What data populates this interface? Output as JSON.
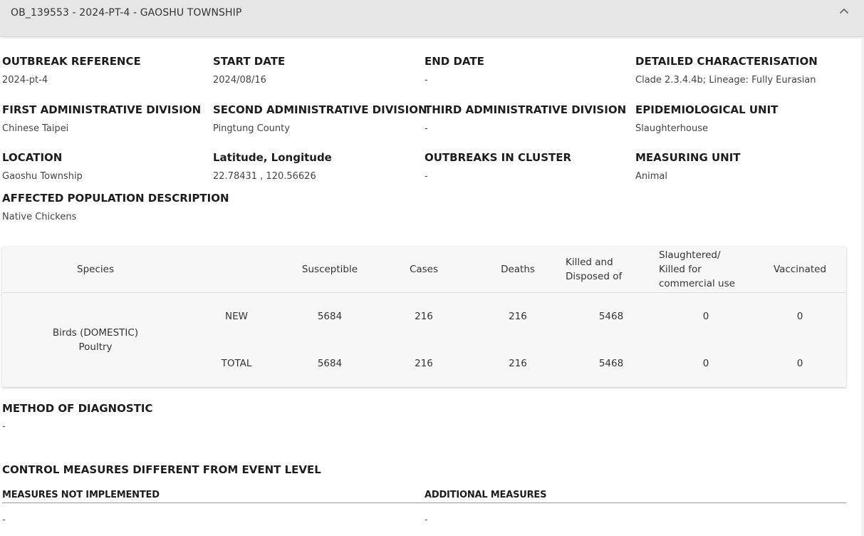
{
  "header": {
    "title": "OB_139553 - 2024-PT-4 - GAOSHU TOWNSHIP",
    "collapse_icon": "chevron-up-icon"
  },
  "fields": {
    "outbreak_reference": {
      "label": "OUTBREAK REFERENCE",
      "value": "2024-pt-4"
    },
    "start_date": {
      "label": "START DATE",
      "value": "2024/08/16"
    },
    "end_date": {
      "label": "END DATE",
      "value": "-"
    },
    "detailed_characterisation": {
      "label": "DETAILED CHARACTERISATION",
      "value": "Clade 2.3.4.4b; Lineage: Fully Eurasian"
    },
    "first_admin_division": {
      "label": "FIRST ADMINISTRATIVE DIVISION",
      "value": "Chinese Taipei"
    },
    "second_admin_division": {
      "label": "SECOND ADMINISTRATIVE DIVISION",
      "value": "Pingtung County"
    },
    "third_admin_division": {
      "label": "THIRD ADMINISTRATIVE DIVISION",
      "value": "-"
    },
    "epidemiological_unit": {
      "label": "EPIDEMIOLOGICAL UNIT",
      "value": "Slaughterhouse"
    },
    "location": {
      "label": "LOCATION",
      "value": "Gaoshu Township"
    },
    "lat_long": {
      "label": "Latitude, Longitude",
      "value": "22.78431 , 120.56626"
    },
    "outbreaks_in_cluster": {
      "label": "OUTBREAKS IN CLUSTER",
      "value": "-"
    },
    "measuring_unit": {
      "label": "MEASURING UNIT",
      "value": "Animal"
    },
    "affected_population": {
      "label": "AFFECTED POPULATION DESCRIPTION",
      "value": "Native Chickens"
    }
  },
  "table": {
    "headers": {
      "species": "Species",
      "susceptible": "Susceptible",
      "cases": "Cases",
      "deaths": "Deaths",
      "killed_line1": "Killed and",
      "killed_line2": "Disposed of",
      "slaughtered_line1": "Slaughtered/",
      "slaughtered_line2": "Killed for",
      "slaughtered_line3": "commercial use",
      "vaccinated": "Vaccinated"
    },
    "species_line1": "Birds (DOMESTIC)",
    "species_line2": "Poultry",
    "rows": [
      {
        "type": "NEW",
        "susceptible": "5684",
        "cases": "216",
        "deaths": "216",
        "killed": "5468",
        "slaughtered": "0",
        "vaccinated": "0"
      },
      {
        "type": "TOTAL",
        "susceptible": "5684",
        "cases": "216",
        "deaths": "216",
        "killed": "5468",
        "slaughtered": "0",
        "vaccinated": "0"
      }
    ]
  },
  "diagnostic": {
    "title": "METHOD OF DIAGNOSTIC",
    "value": "-"
  },
  "control": {
    "title": "CONTROL MEASURES DIFFERENT FROM EVENT LEVEL",
    "not_implemented_label": "MEASURES NOT IMPLEMENTED",
    "not_implemented_value": "-",
    "additional_label": "ADDITIONAL MEASURES",
    "additional_value": "-"
  }
}
